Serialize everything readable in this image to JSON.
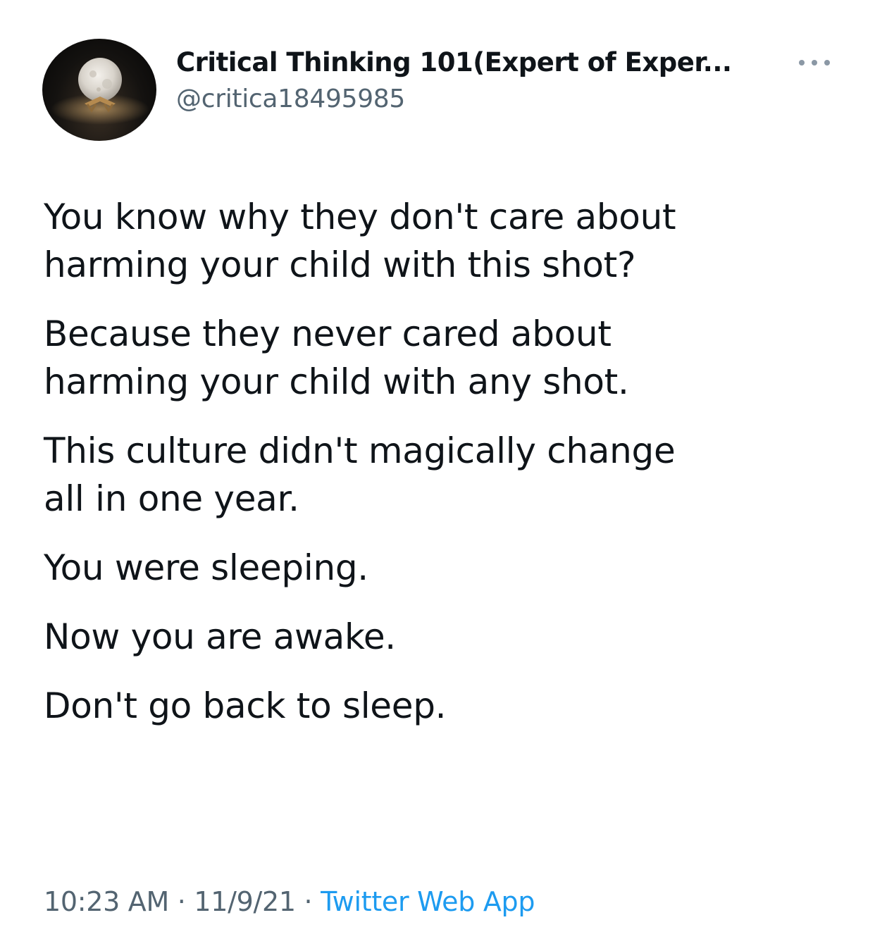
{
  "tweet": {
    "author": {
      "display_name": "Critical Thinking 101(Expert of Exper...",
      "handle": "@critica18495985",
      "avatar_icon": "moon-lamp-avatar"
    },
    "more_icon": "more-horizontal-icon",
    "paragraphs": [
      "You know why they don't care about\nharming your child with this shot?",
      "Because they never cared about\nharming your child with any shot.",
      "This culture didn't magically change\nall in one year.",
      "You were sleeping.",
      "Now you are awake.",
      "Don't go back to sleep."
    ],
    "meta": {
      "time": "10:23 AM",
      "separator": " · ",
      "date": "11/9/21",
      "source": "Twitter Web App"
    }
  },
  "colors": {
    "text": "#0f1419",
    "secondary": "#536471",
    "link": "#1d9bf0"
  }
}
